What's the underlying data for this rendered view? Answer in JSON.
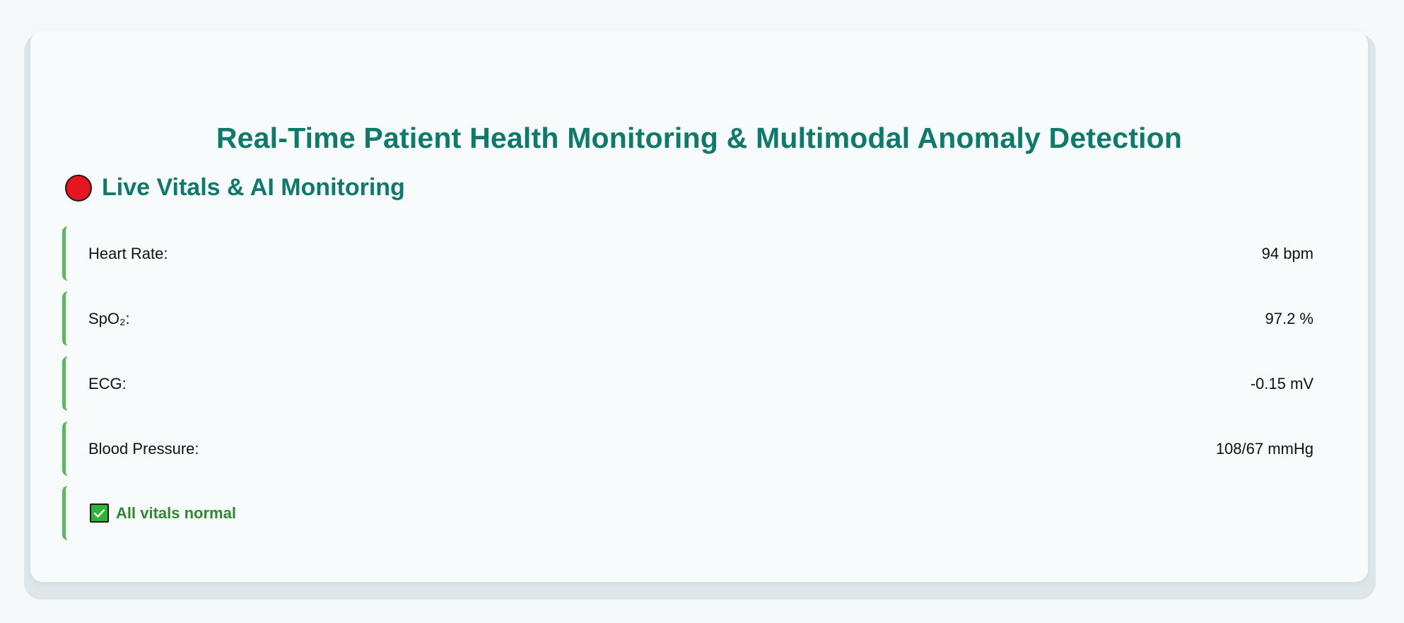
{
  "page": {
    "title": "Real-Time Patient Health Monitoring & Multimodal Anomaly Detection"
  },
  "section": {
    "icon": "red-circle-icon",
    "title": "Live Vitals & AI Monitoring"
  },
  "vitals": [
    {
      "label": "Heart Rate:",
      "value": "94 bpm"
    },
    {
      "label": "SpO₂:",
      "value": "97.2 %"
    },
    {
      "label": "ECG:",
      "value": "-0.15 mV"
    },
    {
      "label": "Blood Pressure:",
      "value": "108/67 mmHg"
    }
  ],
  "status": {
    "icon": "check-box-icon",
    "text": "All vitals normal"
  },
  "colors": {
    "accent": "#0e7a6b",
    "row_border": "#5cb85c",
    "live_dot": "#e8141f",
    "status_text": "#2f8a2f"
  }
}
